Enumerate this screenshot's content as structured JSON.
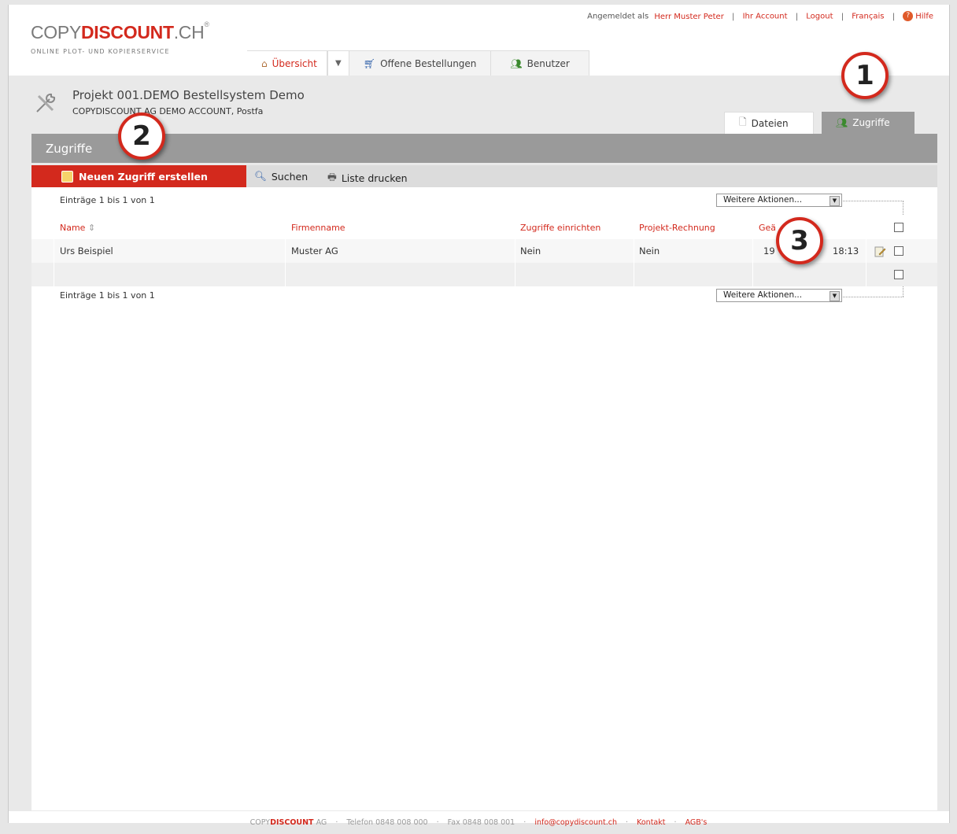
{
  "brand": {
    "logo_prefix": "COPY",
    "logo_main": "DISCOUNT",
    "logo_suffix": ".CH",
    "logo_reg": "®",
    "tagline": "ONLINE PLOT- UND KOPIERSERVICE"
  },
  "toplinks": {
    "logged_in_label": "Angemeldet als",
    "user": "Herr Muster Peter",
    "account": "Ihr Account",
    "logout": "Logout",
    "language": "Français",
    "help": "Hilfe"
  },
  "nav": {
    "overview": "Übersicht",
    "open_orders": "Offene Bestellungen",
    "users": "Benutzer"
  },
  "project": {
    "title": "Projekt 001.DEMO Bestellsystem Demo",
    "subtitle": "COPYDISCOUNT AG DEMO ACCOUNT, Postfa"
  },
  "subtabs": {
    "files": "Dateien",
    "access": "Zugriffe"
  },
  "section_title": "Zugriffe",
  "toolbar": {
    "new_access": "Neuen Zugriff erstellen",
    "search": "Suchen",
    "print_list": "Liste drucken"
  },
  "pagination": {
    "top": "Einträge 1 bis 1 von 1",
    "bottom": "Einträge 1 bis 1 von 1"
  },
  "more_actions": {
    "selected": "Weitere Aktionen..."
  },
  "table": {
    "columns": [
      "Name",
      "Firmenname",
      "Zugriffe einrichten",
      "Projekt-Rechnung",
      "Geä"
    ],
    "rows": [
      {
        "name": "Urs Beispiel",
        "company": "Muster AG",
        "setup_access": "Nein",
        "project_invoice": "Nein",
        "changed_start": "19",
        "changed_end": "18:13"
      }
    ]
  },
  "callouts": {
    "one": "1",
    "two": "2",
    "three": "3"
  },
  "footer": {
    "company_prefix": "COPY",
    "company_main": "DISCOUNT",
    "company_suffix": "AG",
    "phone": "Telefon 0848 008 000",
    "fax": "Fax 0848 008 001",
    "email": "info@copydiscount.ch",
    "contact": "Kontakt",
    "terms": "AGB's",
    "separator": "·"
  },
  "colors": {
    "accent": "#d3291d",
    "section_gray": "#9a9a9a",
    "background": "#e9e9e9"
  }
}
